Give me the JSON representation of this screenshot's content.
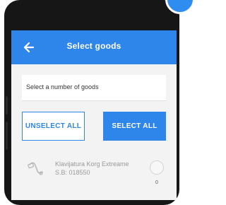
{
  "header": {
    "title": "Select goods",
    "back_icon": "back-arrow-icon"
  },
  "input": {
    "label": "Select a number of goods"
  },
  "buttons": {
    "unselect_all": "UNSELECT ALL",
    "select_all": "SELECT ALL"
  },
  "items": [
    {
      "name": "Klavijatura Korg Extreame",
      "sku": "S.B: 018550",
      "quantity": "0",
      "icon": "keyboard-icon"
    }
  ],
  "colors": {
    "primary": "#2f86ea",
    "device_frame": "#161616",
    "screen_background": "#f3f3f3",
    "muted_text": "#9a9a9a"
  }
}
